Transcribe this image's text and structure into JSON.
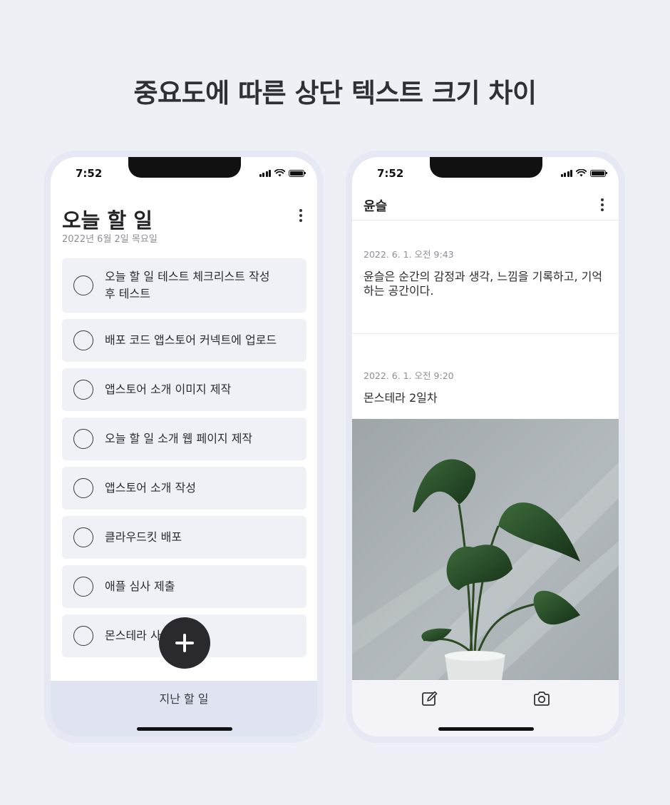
{
  "headline": "중요도에 따른 상단 텍스트 크기 차이",
  "left_phone": {
    "status_time": "7:52",
    "title": "오늘 할 일",
    "date": "2022년 6월 2일 목요일",
    "tasks": [
      "오늘 할 일 테스트 체크리스트 작성 후 테스트",
      "배포 코드 앱스토어 커넥트에 업로드",
      "앱스토어 소개 이미지 제작",
      "오늘 할 일 소개 웹 페이지 제작",
      "앱스토어 소개 작성",
      "클라우드킷 배포",
      "애플 심사 제출",
      "몬스테라 사"
    ],
    "fab_icon": "plus-icon",
    "bottom_tab_label": "지난 할 일"
  },
  "right_phone": {
    "status_time": "7:52",
    "title": "윤슬",
    "entries": [
      {
        "date": "2022. 6. 1. 오전 9:43",
        "text": "윤슬은 순간의 감정과 생각, 느낌을 기록하고, 기억하는 공간이다."
      },
      {
        "date": "2022. 6. 1. 오전 9:20",
        "text": "몬스테라 2일차"
      }
    ],
    "photo": "monstera-plant-photo",
    "toolbar_icons": [
      "compose-icon",
      "camera-icon"
    ]
  },
  "colors": {
    "background": "#edf1f6",
    "phone_frame": "#e6e8f3",
    "task_item": "#f0f1f6",
    "bottom_tab": "#e0e3f1",
    "fab": "#2a2a2e"
  }
}
